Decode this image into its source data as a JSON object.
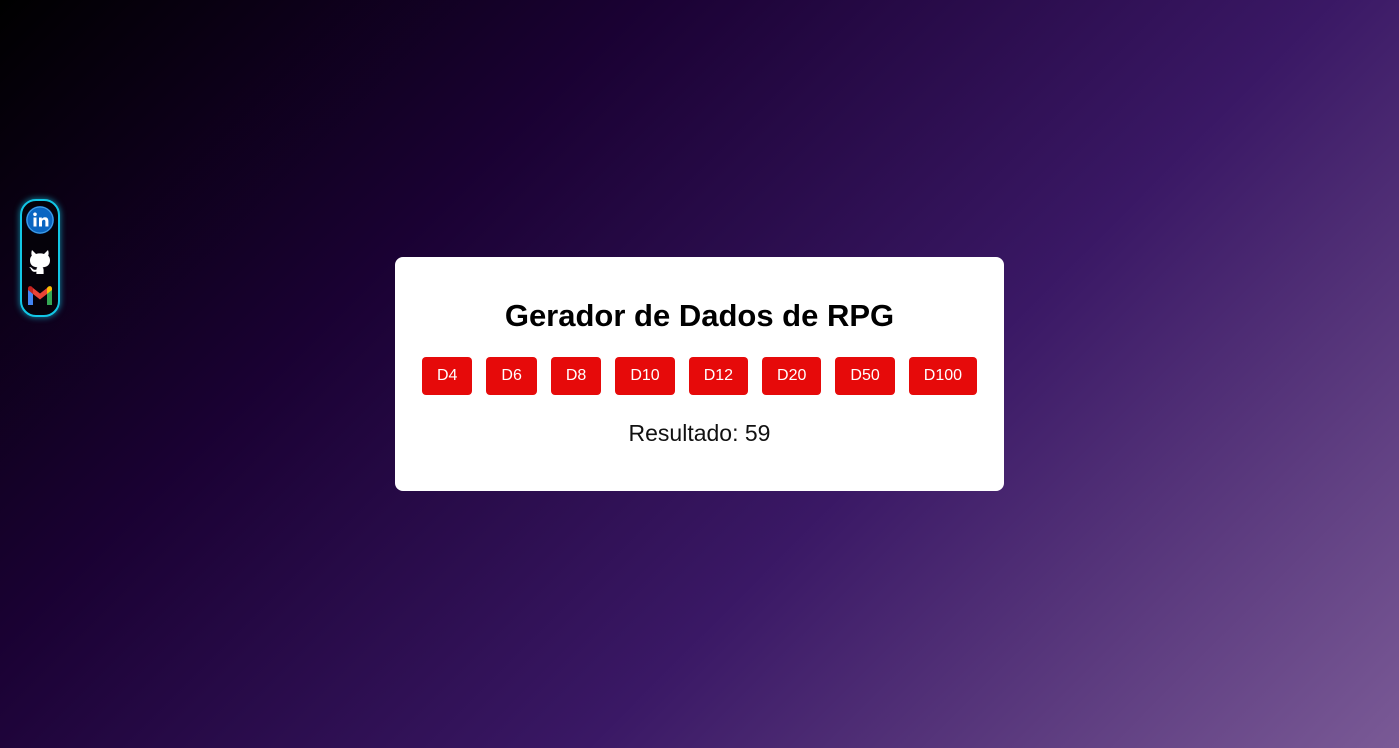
{
  "sidebar": {
    "links": [
      {
        "icon": "linkedin-icon",
        "color": "#0a66c2"
      },
      {
        "icon": "github-icon",
        "color": "#ffffff"
      },
      {
        "icon": "gmail-icon",
        "color": "#ea4335"
      }
    ],
    "border_color": "#12c7e6"
  },
  "card": {
    "title": "Gerador de Dados de RPG",
    "buttons": [
      "D4",
      "D6",
      "D8",
      "D10",
      "D12",
      "D20",
      "D50",
      "D100"
    ],
    "button_color": "#e60a0a",
    "result_label": "Resultado:",
    "result_value": "59"
  }
}
